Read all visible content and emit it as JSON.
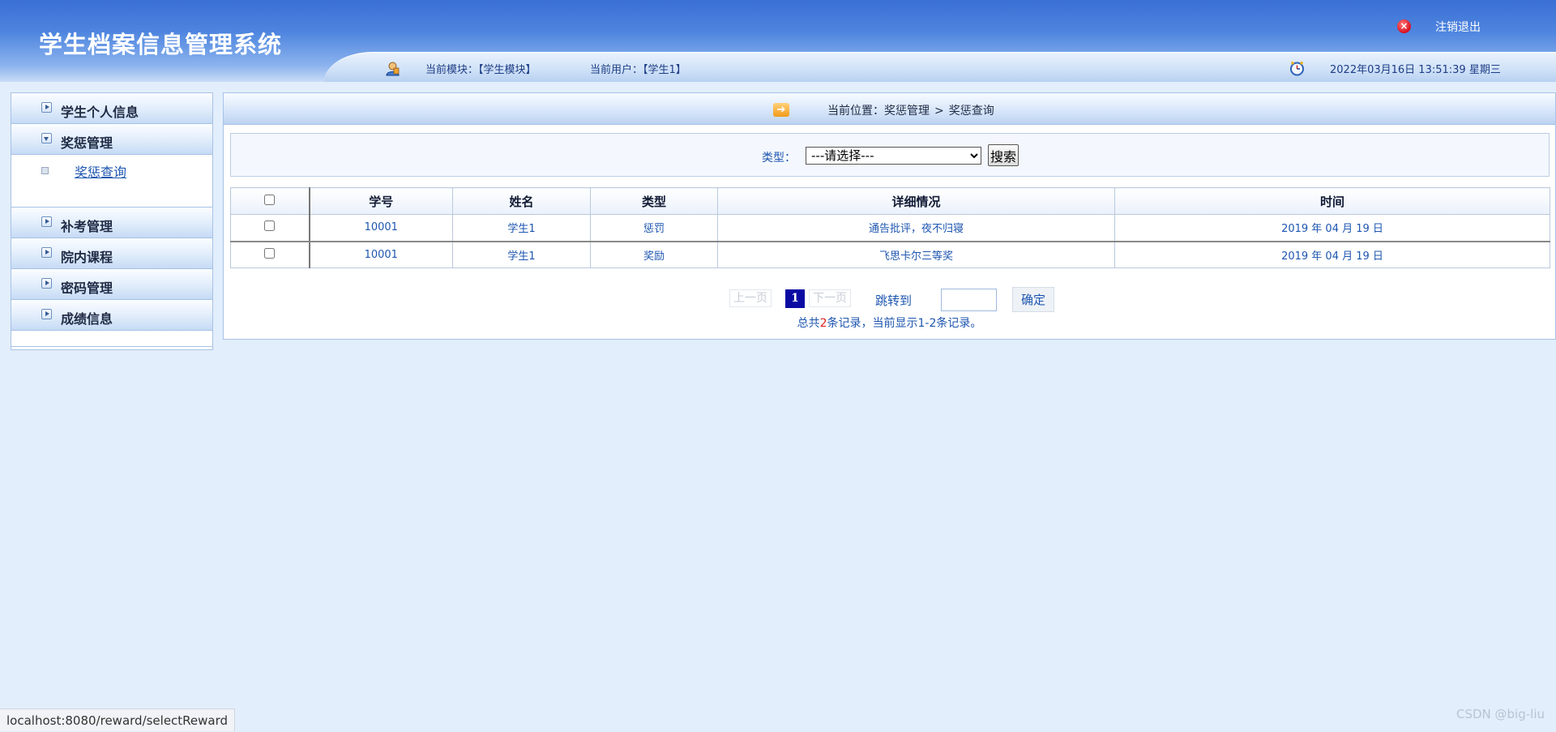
{
  "header": {
    "title": "学生档案信息管理系统",
    "logout_label": "注销退出",
    "module_text": "当前模块：【学生模块】",
    "user_text": "当前用户：【学生1】",
    "datetime_text": "2022年03月16日 13:51:39 星期三"
  },
  "sidebar": {
    "items": [
      {
        "label": "学生个人信息",
        "expanded": false
      },
      {
        "label": "奖惩管理",
        "expanded": true,
        "children": [
          {
            "label": "奖惩查询"
          }
        ]
      },
      {
        "label": "补考管理",
        "expanded": false
      },
      {
        "label": "院内课程",
        "expanded": false
      },
      {
        "label": "密码管理",
        "expanded": false
      },
      {
        "label": "成绩信息",
        "expanded": false
      }
    ]
  },
  "breadcrumb": {
    "prefix": "当前位置：",
    "parent": "奖惩管理",
    "separator": ">",
    "current": "奖惩查询"
  },
  "search": {
    "label": "类型：",
    "select_value": "---请选择---",
    "button_label": "搜索"
  },
  "table": {
    "columns": [
      "学号",
      "姓名",
      "类型",
      "详细情况",
      "时间"
    ],
    "rows": [
      {
        "id": "10001",
        "name": "学生1",
        "type": "惩罚",
        "detail": "通告批评，夜不归寝",
        "time": "2019 年 04 月 19 日"
      },
      {
        "id": "10001",
        "name": "学生1",
        "type": "奖励",
        "detail": "飞思卡尔三等奖",
        "time": "2019 年 04 月 19 日"
      }
    ]
  },
  "pager": {
    "prev_label": "上一页",
    "current_page": "1",
    "next_label": "下一页",
    "jump_label": "跳转到",
    "ok_label": "确定",
    "summary_pre": "总共",
    "summary_count": "2",
    "summary_post": "条记录，当前显示1-2条记录。"
  },
  "statusbar": {
    "url": "localhost:8080/reward/selectReward"
  },
  "watermark": "CSDN @big-liu",
  "colors": {
    "header_blue": "#3a6fd4",
    "link_blue": "#1e56b0",
    "page_bg": "#e2eefb",
    "current_page_bg": "#0a0aa3",
    "count_red": "#e02020",
    "logout_red": "#d80f1e"
  },
  "icons": {
    "logout": "close-circle-icon",
    "user": "user-icon",
    "clock": "clock-icon",
    "crumb": "arrow-right-icon"
  }
}
